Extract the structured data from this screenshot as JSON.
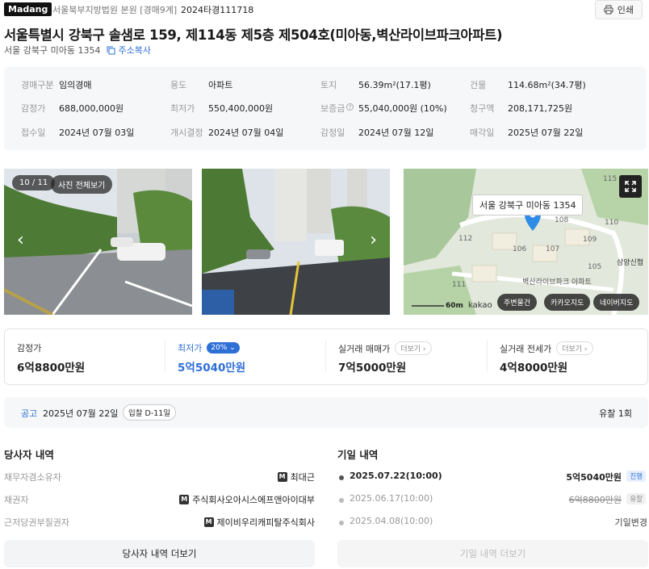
{
  "header": {
    "logo": "Madang",
    "court": "서울북부지방법원 본원 [경매9계]",
    "case_no": "2024타경111718",
    "print_label": "인쇄"
  },
  "address": {
    "title": "서울특별시 강북구 솔샘로 159, 제114동 제5층 제504호(미아동,벽산라이브파크아파트)",
    "sub": "서울 강북구 미아동 1354",
    "copy_label": "주소복사"
  },
  "info": [
    [
      {
        "label": "경매구분",
        "value": "임의경매"
      },
      {
        "label": "용도",
        "value": "아파트"
      },
      {
        "label": "토지",
        "value": "56.39m²(17.1평)"
      },
      {
        "label": "건물",
        "value": "114.68m²(34.7평)"
      }
    ],
    [
      {
        "label": "감정가",
        "value": "688,000,000원"
      },
      {
        "label": "최저가",
        "value": "550,400,000원"
      },
      {
        "label": "보증금",
        "value": "55,040,000원 (10%)"
      },
      {
        "label": "청구액",
        "value": "208,171,725원"
      }
    ],
    [
      {
        "label": "접수일",
        "value": "2024년 07월 03일"
      },
      {
        "label": "개시결정",
        "value": "2024년 07월 04일"
      },
      {
        "label": "감정일",
        "value": "2024년 07월 12일"
      },
      {
        "label": "매각일",
        "value": "2025년 07월 22일"
      }
    ]
  ],
  "photos": {
    "counter": "10 / 11",
    "view_all": "사진 전체보기"
  },
  "map": {
    "label": "서울 강북구 미아동 1354",
    "complex": "벽산라이브파크 아파트",
    "place": "삼양신협",
    "scale": "60m",
    "brand": "kakao",
    "numbers": [
      "115",
      "108",
      "110",
      "112",
      "106",
      "107",
      "109",
      "105",
      "111"
    ],
    "buttons": [
      "주변물건",
      "카카오지도",
      "네이버지도"
    ]
  },
  "prices": {
    "appraisal": {
      "label": "감정가",
      "value": "6억8800만원"
    },
    "minimum": {
      "label": "최저가",
      "badge": "20%",
      "value": "5억5040만원"
    },
    "trade": {
      "label": "실거래 매매가",
      "more": "더보기",
      "value": "7억5000만원"
    },
    "jeonse": {
      "label": "실거래 전세가",
      "more": "더보기",
      "value": "4억8000만원"
    }
  },
  "notice": {
    "label": "공고",
    "date": "2025년 07월 22일",
    "dday": "입찰 D-11일",
    "round": "유찰 1회"
  },
  "parties": {
    "title": "당사자 내역",
    "rows": [
      {
        "label": "채무자겸소유자",
        "value": "최대근"
      },
      {
        "label": "채권자",
        "value": "주식회사오아시스에프앤아이대부"
      },
      {
        "label": "근저당권부질권자",
        "value": "제이비우리캐피탈주식회사"
      }
    ],
    "more": "당사자 내역 더보기"
  },
  "history": {
    "title": "기일 내역",
    "rows": [
      {
        "date": "2025.07.22(10:00)",
        "price": "5억5040만원",
        "tag": "진행"
      },
      {
        "date": "2025.06.17(10:00)",
        "price": "6억8800만원",
        "tag": "유찰"
      },
      {
        "date": "2025.04.08(10:00)",
        "price": "기일변경",
        "tag": ""
      }
    ],
    "more": "기일 내역 더보기"
  },
  "colors": {
    "accent": "#2e6fd6",
    "map_pin": "#2e8ce6"
  }
}
